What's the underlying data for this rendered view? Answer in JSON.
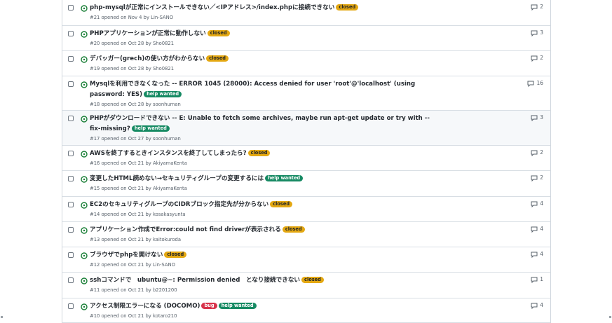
{
  "issues": [
    {
      "title": "php-mysqlが正常にインストールできない／<IPアドレス>/index.phpに接続できない",
      "labels": [
        {
          "text": "closed",
          "type": "closed"
        }
      ],
      "meta": "#21 opened on Nov 4 by Lin-SANO",
      "comments": "2"
    },
    {
      "title": "PHPアプリケーションが正常に動作しない",
      "labels": [
        {
          "text": "closed",
          "type": "closed"
        }
      ],
      "meta": "#20 opened on Oct 28 by Sho0821",
      "comments": "3"
    },
    {
      "title": "デバッガー(grech)の使い方がわからない",
      "labels": [
        {
          "text": "closed",
          "type": "closed"
        }
      ],
      "meta": "#19 opened on Oct 28 by Sho0821",
      "comments": "2"
    },
    {
      "title": "Mysqlを利用できなくなった -- ERROR 1045 (28000): Access denied for user 'root'@'localhost' (using password: YES)",
      "labels": [
        {
          "text": "help wanted",
          "type": "help"
        }
      ],
      "meta": "#18 opened on Oct 28 by soonhuman",
      "comments": "16"
    },
    {
      "title": "PHPがダウンロードできない -- E: Unable to fetch some archives, maybe run apt-get update or try with --fix-missing?",
      "labels": [
        {
          "text": "help wanted",
          "type": "help"
        }
      ],
      "meta": "#17 opened on Oct 27 by soonhuman",
      "comments": "3"
    },
    {
      "title": "AWSを終了するときインスタンスを終了してしまったら?",
      "labels": [
        {
          "text": "closed",
          "type": "closed"
        }
      ],
      "meta": "#16 opened on Oct 21 by AkiyamaKenta",
      "comments": "2"
    },
    {
      "title": "変更したHTML読めない→セキュリティグループの変更するには",
      "labels": [
        {
          "text": "help wanted",
          "type": "help"
        }
      ],
      "meta": "#15 opened on Oct 21 by AkiyamaKenta",
      "comments": "2"
    },
    {
      "title": "EC2のセキュリティグループのCIDRブロック指定先が分からない",
      "labels": [
        {
          "text": "closed",
          "type": "closed"
        }
      ],
      "meta": "#14 opened on Oct 21 by kosakasyunta",
      "comments": "4"
    },
    {
      "title": "アプリケーション作成でError:could not find driverが表示される",
      "labels": [
        {
          "text": "closed",
          "type": "closed"
        }
      ],
      "meta": "#13 opened on Oct 21 by kaitokuroda",
      "comments": "4"
    },
    {
      "title": "ブラウザでphpを開けない",
      "labels": [
        {
          "text": "closed",
          "type": "closed"
        }
      ],
      "meta": "#12 opened on Oct 21 by Lin-SANO",
      "comments": "4"
    },
    {
      "title": "sshコマンドで　ubuntu@~: Permission denied　となり接続できない",
      "labels": [
        {
          "text": "closed",
          "type": "closed"
        }
      ],
      "meta": "#11 opened on Oct 21 by b2201200",
      "comments": "1"
    },
    {
      "title": "アクセス制限エラーになる (DOCOMO)",
      "labels": [
        {
          "text": "bug",
          "type": "bug"
        },
        {
          "text": "help wanted",
          "type": "help"
        }
      ],
      "meta": "#10 opened on Oct 21 by kotaro210",
      "comments": "4"
    }
  ]
}
